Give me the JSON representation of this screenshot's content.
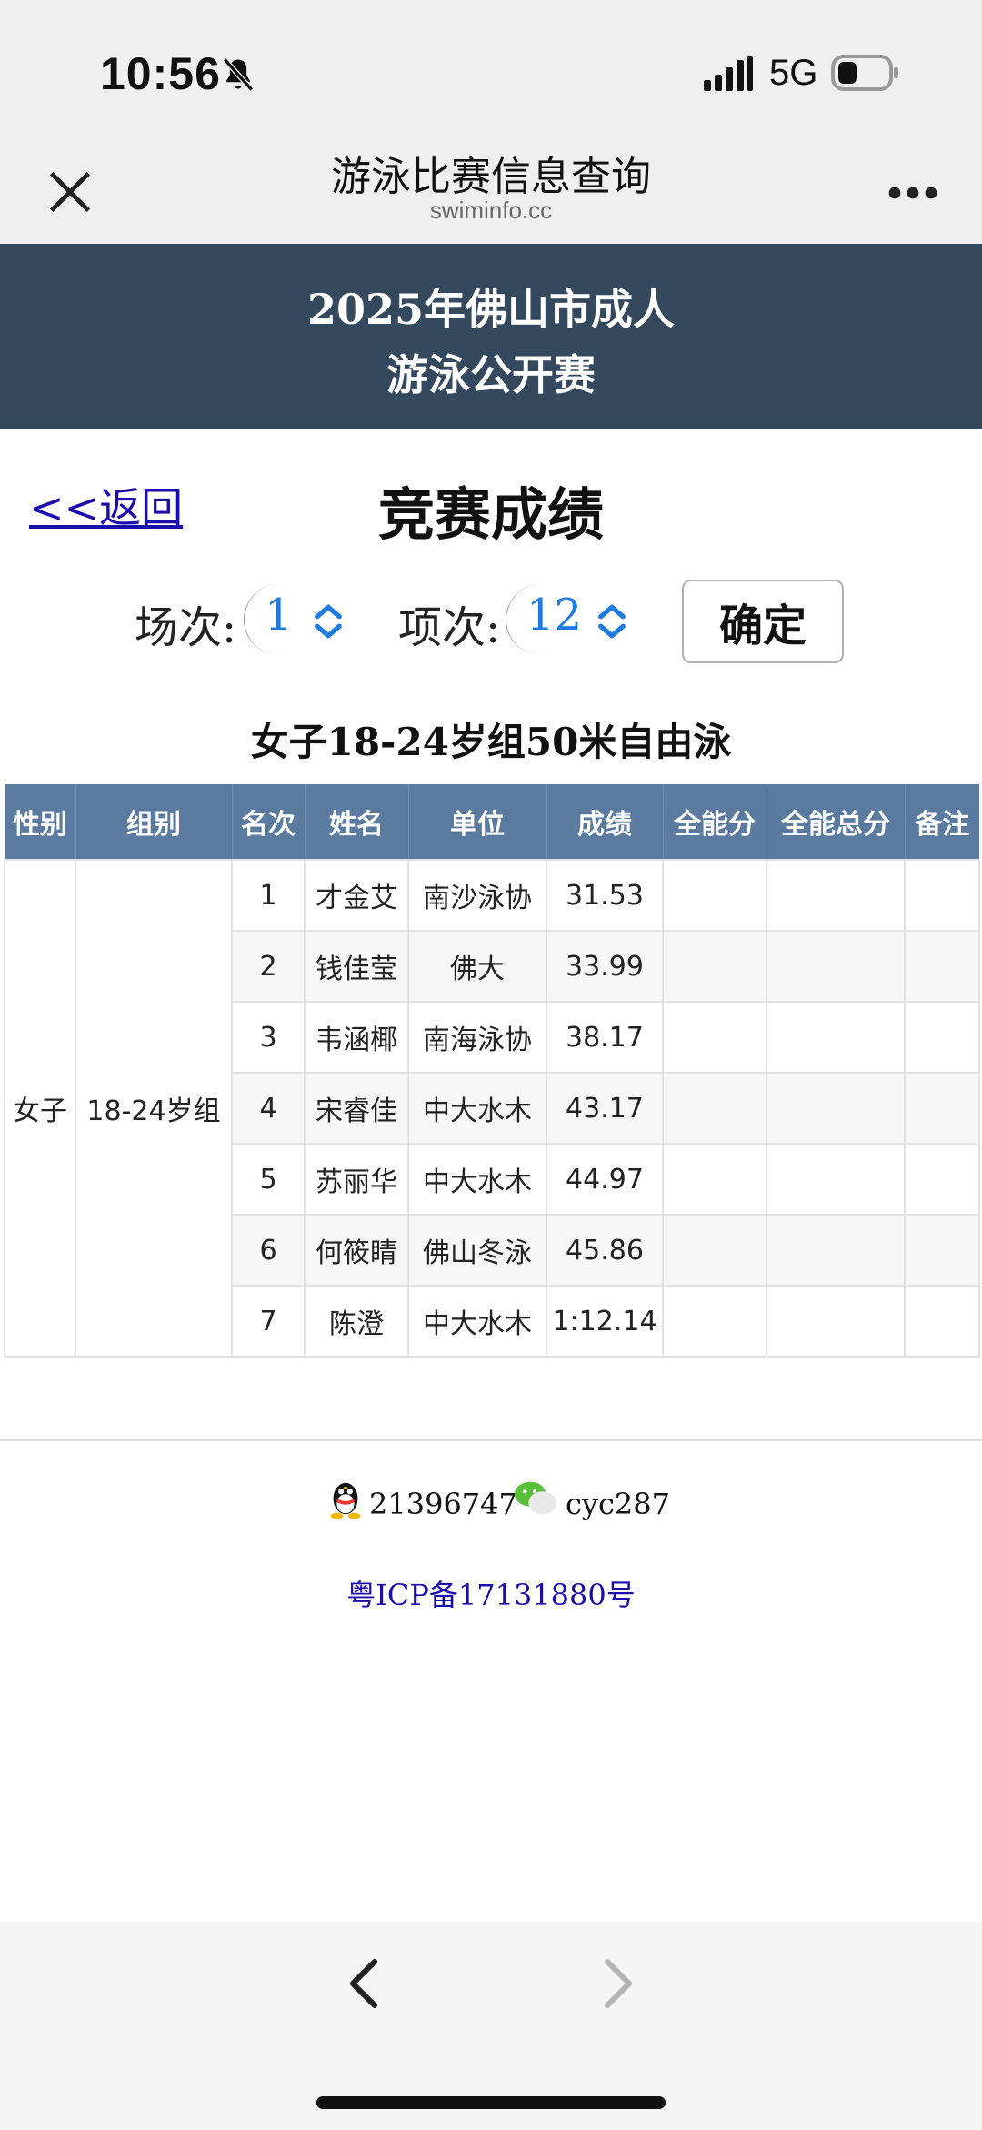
{
  "status_bar": {
    "time": "10:56",
    "network": "5G"
  },
  "nav": {
    "title": "游泳比赛信息查询",
    "subtitle": "swiminfo.cc"
  },
  "banner": {
    "line1": "2025年佛山市成人",
    "line2": "游泳公开赛"
  },
  "page": {
    "back_label": "<<返回",
    "title": "竞赛成绩"
  },
  "filters": {
    "session_label": "场次:",
    "session_value": "1",
    "event_label": "项次:",
    "event_value": "12",
    "confirm_label": "确定"
  },
  "event_title": "女子18-24岁组50米自由泳",
  "table": {
    "headers": [
      "性别",
      "组别",
      "名次",
      "姓名",
      "单位",
      "成绩",
      "全能分",
      "全能总分",
      "备注"
    ],
    "gender": "女子",
    "group": "18-24岁组",
    "rows": [
      {
        "rank": "1",
        "name": "才金艾",
        "unit": "南沙泳协",
        "result": "31.53"
      },
      {
        "rank": "2",
        "name": "钱佳莹",
        "unit": "佛大",
        "result": "33.99"
      },
      {
        "rank": "3",
        "name": "韦涵椰",
        "unit": "南海泳协",
        "result": "38.17"
      },
      {
        "rank": "4",
        "name": "宋睿佳",
        "unit": "中大水木",
        "result": "43.17"
      },
      {
        "rank": "5",
        "name": "苏丽华",
        "unit": "中大水木",
        "result": "44.97"
      },
      {
        "rank": "6",
        "name": "何筱睛",
        "unit": "佛山冬泳",
        "result": "45.86"
      },
      {
        "rank": "7",
        "name": "陈澄",
        "unit": "中大水木",
        "result": "1:12.14"
      }
    ]
  },
  "footer": {
    "qq": "21396747",
    "wechat": "cyc287",
    "icp": "粤ICP备17131880号"
  },
  "icons": [
    "bell-slash-icon",
    "signal-icon",
    "battery-icon",
    "close-icon",
    "more-icon",
    "chevron-updown-icon",
    "qq-icon",
    "wechat-icon",
    "back-arrow-icon",
    "forward-arrow-icon"
  ],
  "colors": {
    "banner": "#34495e",
    "table_header": "#5a7aa0",
    "link": "#1a0dab",
    "select_value": "#1e7be0"
  }
}
